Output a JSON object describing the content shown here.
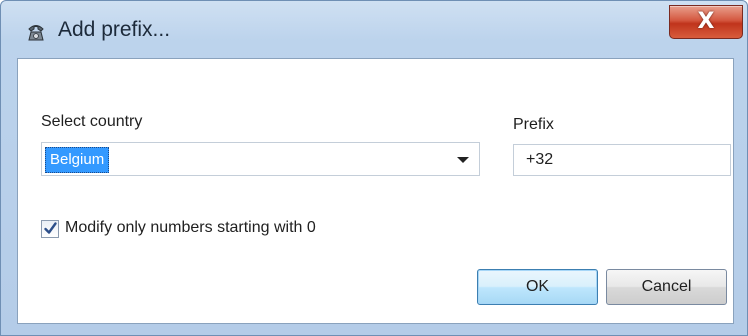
{
  "window": {
    "title": "Add prefix...",
    "title_icon": "phone-icon",
    "close_glyph": "X"
  },
  "form": {
    "country_label": "Select country",
    "country_value": "Belgium",
    "prefix_label": "Prefix",
    "prefix_value": "+32",
    "checkbox_label": "Modify only numbers starting with 0",
    "checkbox_checked": true
  },
  "buttons": {
    "ok_label": "OK",
    "cancel_label": "Cancel"
  },
  "colors": {
    "selection": "#3399ff",
    "close_button": "#c0341c",
    "titlebar": "#bcd3ec"
  }
}
